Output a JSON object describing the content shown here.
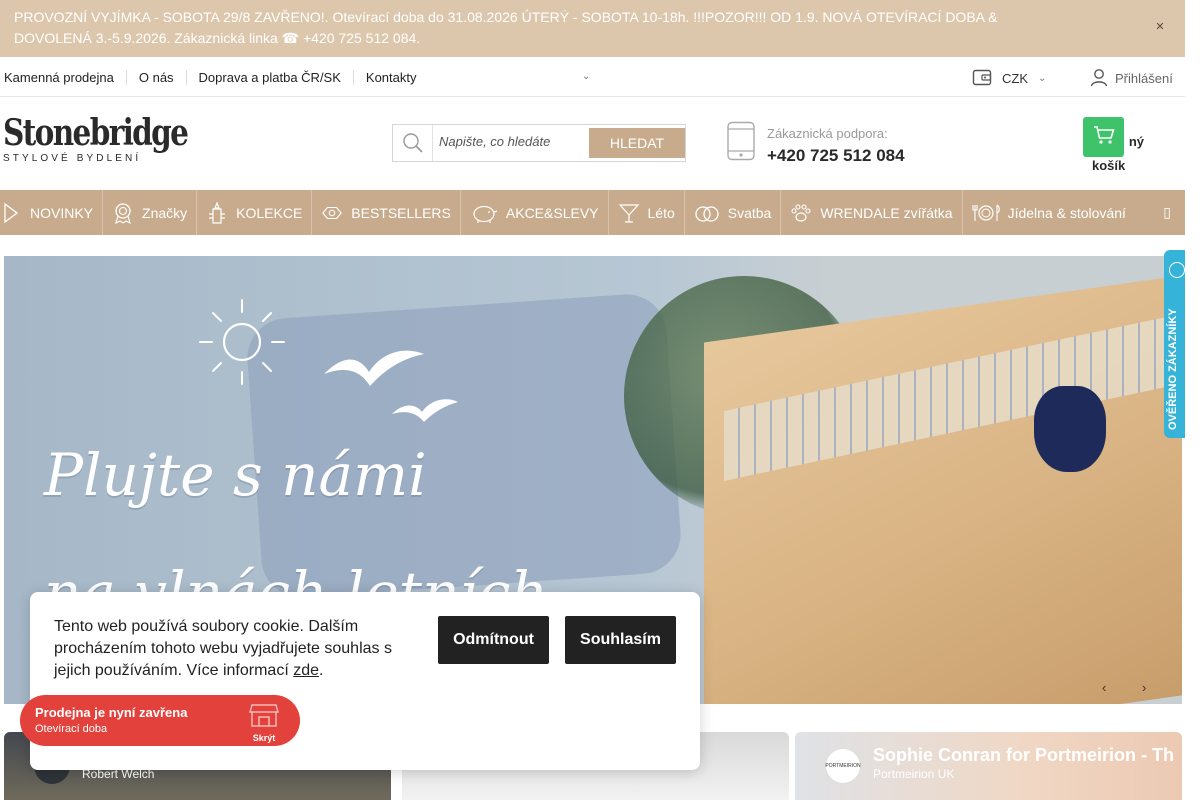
{
  "announcement": {
    "text": "PROVOZNÍ VYJÍMKA - SOBOTA 29/8 ZAVŘENO!. Otevírací doba do 31.08.2026 ÚTERÝ - SOBOTA 10-18h. !!!POZOR!!! OD 1.9. NOVÁ OTEVÍRACÍ DOBA & DOVOLENÁ 3.-5.9.2026. Zákaznická linka ☎ +420 725 512 084.",
    "close_icon": "close-icon"
  },
  "topnav": {
    "links": [
      "Kamenná prodejna",
      "O nás",
      "Doprava a platba ČR/SK",
      "Kontakty"
    ],
    "currency": "CZK",
    "login": "Přihlášení"
  },
  "header": {
    "logo_main": "Stonebridge",
    "logo_sub": "STYLOVÉ BYDLENÍ",
    "search_placeholder": "Napište, co hledáte",
    "search_button": "HLEDAT",
    "support_label": "Zákaznická podpora:",
    "support_phone": "+420 725 512 084",
    "cart_line1": "ný",
    "cart_line2": "košík"
  },
  "categories": [
    {
      "label": "NOVINKY",
      "icon": "star-icon"
    },
    {
      "label": "Značky",
      "icon": "badge-icon"
    },
    {
      "label": "KOLEKCE",
      "icon": "collection-icon"
    },
    {
      "label": "BESTSELLERS",
      "icon": "best-icon"
    },
    {
      "label": "AKCE&SLEVY",
      "icon": "piggy-bank-icon"
    },
    {
      "label": "Léto",
      "icon": "cocktail-icon"
    },
    {
      "label": "Svatba",
      "icon": "rings-icon"
    },
    {
      "label": "WRENDALE zvířátka",
      "icon": "paw-icon"
    },
    {
      "label": "Jídelna & stolování",
      "icon": "cutlery-icon"
    }
  ],
  "hero": {
    "line1": "Plujte s námi",
    "line2": "na vlnách letních slev"
  },
  "verified": {
    "text": "OVĚŘENO ZÁKAZNÍKY"
  },
  "cookie": {
    "text": "Tento web používá soubory cookie. Dalším procházením tohoto webu vyjadřujete souhlas s jejich používáním. Více informací",
    "link": "zde",
    "trailing": ".",
    "reject": "Odmítnout",
    "accept": "Souhlasím"
  },
  "store": {
    "status": "Prodejna je nyní zavřena",
    "hours_link": "Otevírací doba",
    "hide": "Skrýt"
  },
  "videos": [
    {
      "title": "",
      "channel": "Robert Welch"
    },
    {
      "title": "",
      "channel": ""
    },
    {
      "title": "Sophie Conran for Portmeirion - Th",
      "channel": "Portmeirion UK"
    }
  ],
  "colors": {
    "accent": "#c8ab8d",
    "announcement": "#ddc7ac",
    "cart": "#3ec36a",
    "store_closed": "#e3413b",
    "verified": "#36b3d9"
  }
}
